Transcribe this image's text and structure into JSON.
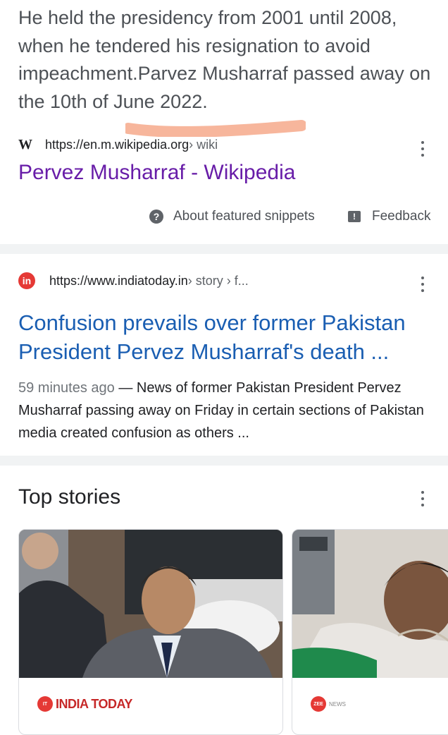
{
  "featured": {
    "snippet": "He held the presidency from 2001 until 2008, when he tendered his resignation to avoid impeachment.Parvez Musharraf passed away on the 10th of June 2022.",
    "source_logo": "W",
    "source_url": "https://en.m.wikipedia.org",
    "source_crumb": " › wiki",
    "title": "Pervez Musharraf - Wikipedia",
    "about_label": "About featured snippets",
    "feedback_label": "Feedback"
  },
  "result": {
    "logo": "in",
    "url": "https://www.indiatoday.in",
    "crumb": " › story › f...",
    "title": "Confusion prevails over former Pakistan President Pervez Musharraf's death ...",
    "time": "59 minutes ago",
    "description": " — News of former Pakistan President Pervez Musharraf passing away on Friday in certain sections of Pakistan media created confusion as others ..."
  },
  "top_stories": {
    "heading": "Top stories",
    "stories": [
      {
        "source": "INDIA TODAY",
        "logo_text": "INDIA TODAY"
      },
      {
        "source": "NEWS",
        "logo_text": "ZEE"
      }
    ]
  },
  "colors": {
    "visited_link": "#681da8",
    "link": "#1a5eb2",
    "highlight": "#f7b69c",
    "brand_red": "#e53935"
  },
  "icons": {
    "about": "help-circle-icon",
    "feedback": "feedback-icon",
    "more": "more-vert-icon"
  }
}
